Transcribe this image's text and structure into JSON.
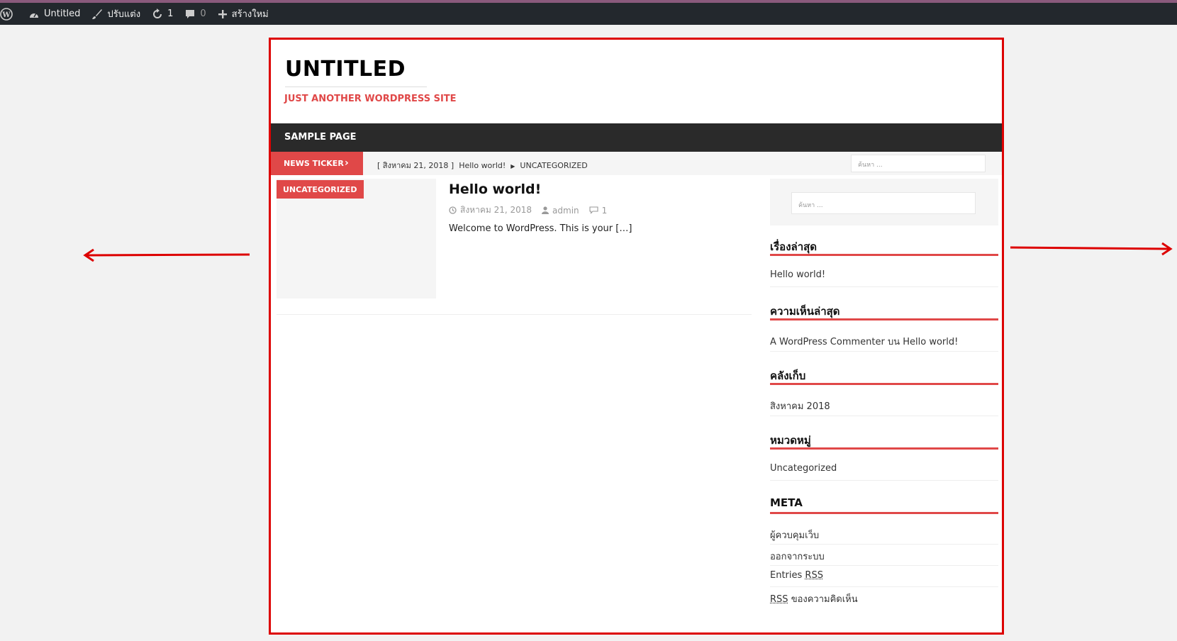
{
  "adminbar": {
    "site_name": "Untitled",
    "customize": "ปรับแต่ง",
    "updates_count": "1",
    "comments_count": "0",
    "new_label": "สร้างใหม่"
  },
  "header": {
    "title": "UNTITLED",
    "description": "JUST ANOTHER WORDPRESS SITE"
  },
  "nav": {
    "items": [
      "SAMPLE PAGE"
    ]
  },
  "ticker": {
    "label": "NEWS TICKER",
    "date": "[ สิงหาคม 21, 2018 ]",
    "headline": "Hello world!",
    "category": "UNCATEGORIZED",
    "search_placeholder": "ค้นหา ..."
  },
  "post": {
    "category": "UNCATEGORIZED",
    "title": "Hello world!",
    "date": "สิงหาคม 21, 2018",
    "author": "admin",
    "comments": "1",
    "excerpt": "Welcome to WordPress. This is your",
    "more": "[…]"
  },
  "sidebar": {
    "search_placeholder": "ค้นหา ...",
    "recent_posts": {
      "title": "เรื่องล่าสุด",
      "items": [
        "Hello world!"
      ]
    },
    "recent_comments": {
      "title": "ความเห็นล่าสุด",
      "author": "A WordPress Commenter",
      "on": "บน",
      "post": "Hello world!"
    },
    "archives": {
      "title": "คลังเก็บ",
      "items": [
        "สิงหาคม 2018"
      ]
    },
    "categories": {
      "title": "หมวดหมู่",
      "items": [
        "Uncategorized"
      ]
    },
    "meta": {
      "title": "META",
      "admin": "ผู้ควบคุมเว็บ",
      "logout": "ออกจากระบบ",
      "entries": "Entries",
      "rss": "RSS",
      "comments_suffix": "ของความคิดเห็น"
    }
  },
  "colors": {
    "accent": "#e04848",
    "annotation": "#dd0000",
    "adminbar": "#23282d"
  }
}
